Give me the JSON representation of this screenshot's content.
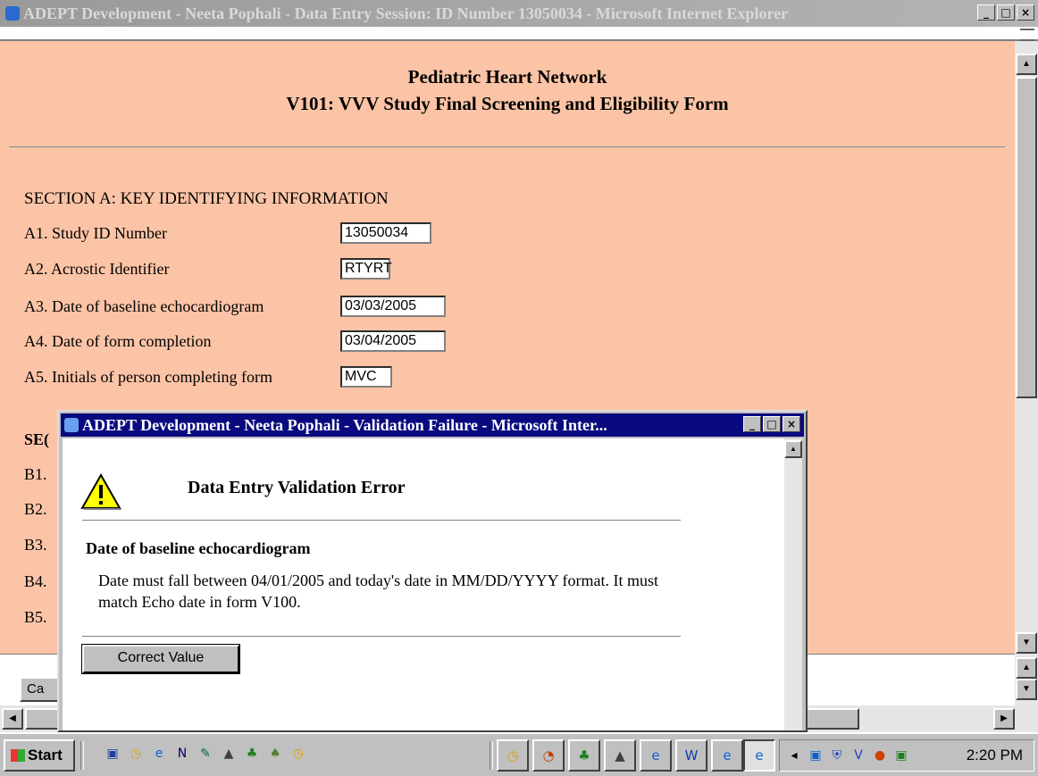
{
  "main_window": {
    "title": "ADEPT Development - Neeta Pophali - Data Entry Session: ID Number 13050034 - Microsoft Internet Explorer"
  },
  "form": {
    "org": "Pediatric Heart Network",
    "title": "V101: VVV Study Final Screening and Eligibility Form",
    "section_a": "SECTION A: KEY IDENTIFYING INFORMATION",
    "fields": [
      {
        "label": "A1.  Study ID Number",
        "value": "13050034"
      },
      {
        "label": "A2.  Acrostic Identifier",
        "value": "RTYRT"
      },
      {
        "label": "A3.  Date of baseline echocardiogram",
        "value": "03/03/2005"
      },
      {
        "label": "A4.  Date of form completion",
        "value": "03/04/2005"
      },
      {
        "label": "A5.  Initials of person completing form",
        "value": "MVC"
      }
    ],
    "section_b_partial": "SE(",
    "b_items": [
      "B1.",
      "B2.",
      "B3.",
      "B4.",
      "B5."
    ],
    "cancel_partial": "Ca"
  },
  "dialog": {
    "title": "ADEPT Development - Neeta Pophali - Validation Failure - Microsoft Inter...",
    "heading": "Data Entry Validation Error",
    "field": "Date of baseline echocardiogram",
    "message": "Date must fall between 04/01/2005 and today's date in MM/DD/YYYY format. It must match Echo date in form V100.",
    "button": "Correct Value"
  },
  "taskbar": {
    "start": "Start",
    "clock": "2:20 PM"
  },
  "window_buttons": {
    "minimize": "_",
    "maximize": "□",
    "close": "×"
  }
}
